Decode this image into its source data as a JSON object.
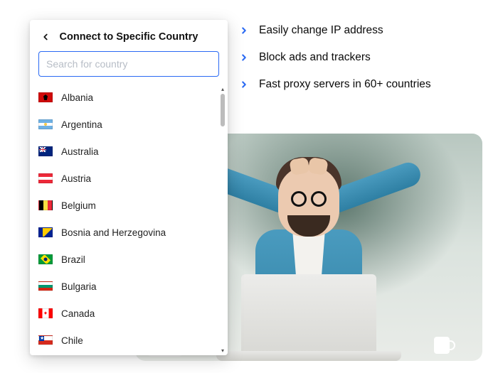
{
  "panel": {
    "title": "Connect to Specific Country",
    "search_placeholder": "Search for country",
    "countries": [
      {
        "name": "Albania",
        "flag": "flag-albania"
      },
      {
        "name": "Argentina",
        "flag": "flag-argentina"
      },
      {
        "name": "Australia",
        "flag": "flag-australia"
      },
      {
        "name": "Austria",
        "flag": "flag-austria"
      },
      {
        "name": "Belgium",
        "flag": "flag-belgium"
      },
      {
        "name": "Bosnia and Herzegovina",
        "flag": "flag-bosnia"
      },
      {
        "name": "Brazil",
        "flag": "flag-brazil"
      },
      {
        "name": "Bulgaria",
        "flag": "flag-bulgaria"
      },
      {
        "name": "Canada",
        "flag": "flag-canada"
      },
      {
        "name": "Chile",
        "flag": "flag-chile"
      }
    ]
  },
  "features": [
    "Easily change IP address",
    "Block ads and trackers",
    "Fast proxy servers in 60+ countries"
  ],
  "colors": {
    "accent": "#2a6af3"
  }
}
